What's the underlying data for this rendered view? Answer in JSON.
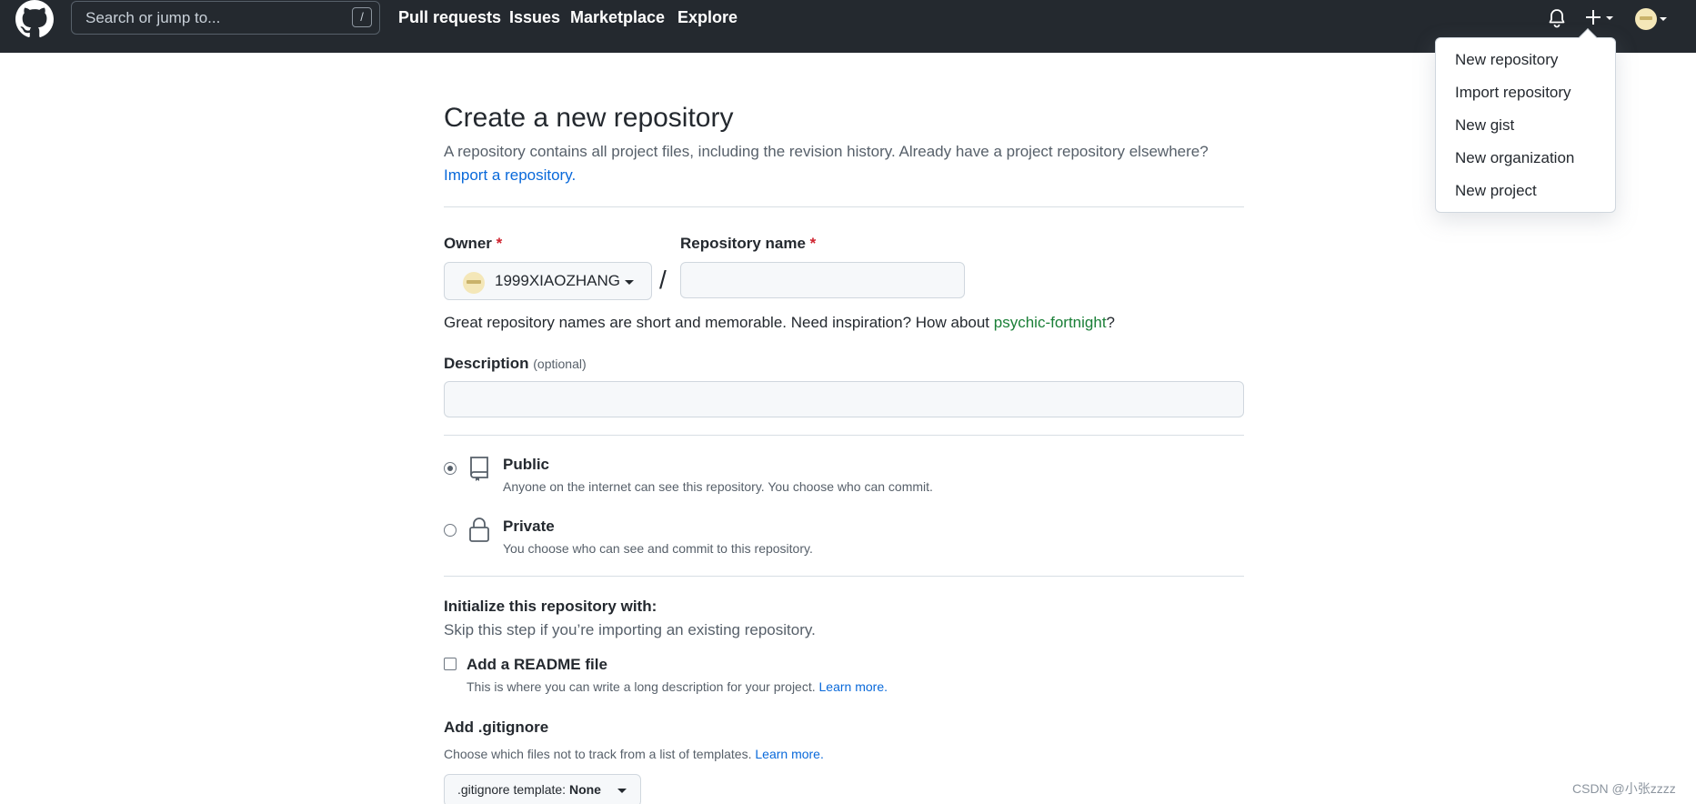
{
  "header": {
    "logo_icon": "github-mark-icon",
    "search_placeholder": "Search or jump to...",
    "search_shortcut": "/",
    "nav": [
      "Pull requests",
      "Issues",
      "Marketplace",
      "Explore"
    ],
    "bell_icon": "bell-icon",
    "plus_icon": "plus-icon",
    "avatar_icon": "user-avatar"
  },
  "dropdown": {
    "items": [
      "New repository",
      "Import repository",
      "New gist",
      "New organization",
      "New project"
    ]
  },
  "form": {
    "title": "Create a new repository",
    "subtitle": "A repository contains all project files, including the revision history. Already have a project repository elsewhere?",
    "import_link": "Import a repository.",
    "owner_label": "Owner",
    "required_mark": "*",
    "owner_value": "1999XIAOZHANG",
    "separator": "/",
    "repo_name_label": "Repository name",
    "repo_name_value": "",
    "hint_prefix": "Great repository names are short and memorable. Need inspiration? How about ",
    "hint_suggestion": "psychic-fortnight",
    "hint_suffix": "?",
    "description_label": "Description",
    "description_optional": "(optional)",
    "description_value": "",
    "visibility": [
      {
        "title": "Public",
        "desc": "Anyone on the internet can see this repository. You choose who can commit.",
        "icon": "repo-icon",
        "checked": true
      },
      {
        "title": "Private",
        "desc": "You choose who can see and commit to this repository.",
        "icon": "lock-icon",
        "checked": false
      }
    ],
    "init_title": "Initialize this repository with:",
    "init_subtitle": "Skip this step if you’re importing an existing repository.",
    "readme_label": "Add a README file",
    "readme_desc": "This is where you can write a long description for your project. ",
    "learn_more": "Learn more.",
    "gitignore_title": "Add .gitignore",
    "gitignore_desc": "Choose which files not to track from a list of templates. ",
    "gitignore_btn_prefix": ".gitignore template: ",
    "gitignore_btn_value": "None"
  },
  "watermark": "CSDN @小张zzzz",
  "colors": {
    "header_bg": "#24292f",
    "link": "#0969da",
    "required": "#cf222e",
    "suggestion": "#1a7f37"
  }
}
